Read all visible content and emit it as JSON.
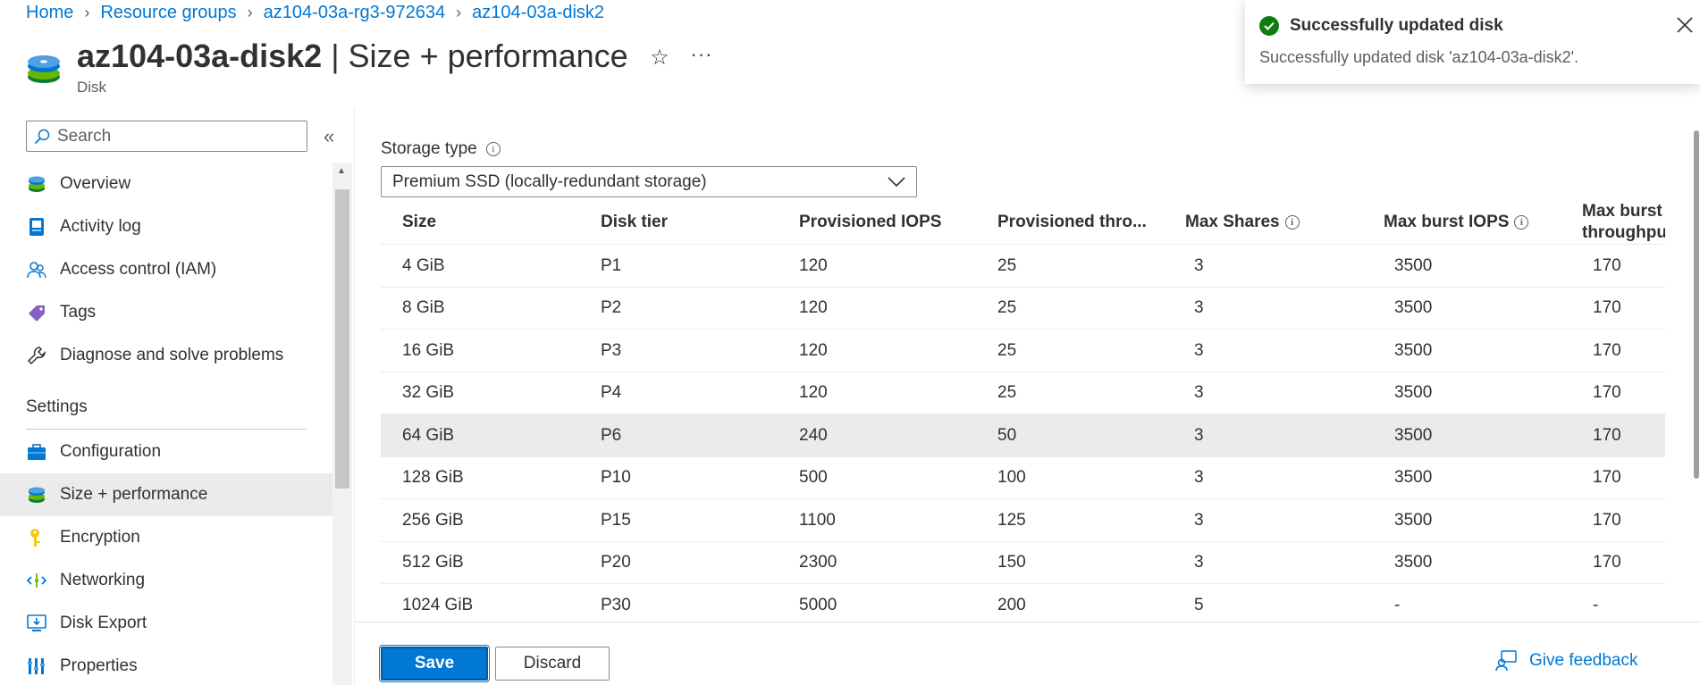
{
  "breadcrumb": [
    "Home",
    "Resource groups",
    "az104-03a-rg3-972634",
    "az104-03a-disk2"
  ],
  "header": {
    "title_resource": "az104-03a-disk2",
    "title_separator": " | ",
    "title_blade": "Size + performance",
    "subtitle": "Disk",
    "more_label": "···",
    "star_label": "☆"
  },
  "sidebar": {
    "search_placeholder": "Search",
    "collapse_label": "«",
    "items": [
      {
        "label": "Overview",
        "icon": "disk-icon"
      },
      {
        "label": "Activity log",
        "icon": "activity-log-icon"
      },
      {
        "label": "Access control (IAM)",
        "icon": "people-icon"
      },
      {
        "label": "Tags",
        "icon": "tag-icon"
      },
      {
        "label": "Diagnose and solve problems",
        "icon": "wrench-icon"
      }
    ],
    "settings_header": "Settings",
    "settings_items": [
      {
        "label": "Configuration",
        "icon": "toolbox-icon"
      },
      {
        "label": "Size + performance",
        "icon": "disk-icon"
      },
      {
        "label": "Encryption",
        "icon": "key-icon"
      },
      {
        "label": "Networking",
        "icon": "network-icon"
      },
      {
        "label": "Disk Export",
        "icon": "monitor-download-icon"
      },
      {
        "label": "Properties",
        "icon": "properties-icon"
      }
    ]
  },
  "storage": {
    "label": "Storage type",
    "selected": "Premium SSD (locally-redundant storage)"
  },
  "table": {
    "columns": [
      "Size",
      "Disk tier",
      "Provisioned IOPS",
      "Provisioned thro...",
      "Max Shares",
      "Max burst IOPS",
      "Max burst throughpu"
    ],
    "max_burst_line1": "Max burst",
    "max_burst_line2": "throughpu",
    "rows": [
      [
        "4 GiB",
        "P1",
        "120",
        "25",
        "3",
        "3500",
        "170"
      ],
      [
        "8 GiB",
        "P2",
        "120",
        "25",
        "3",
        "3500",
        "170"
      ],
      [
        "16 GiB",
        "P3",
        "120",
        "25",
        "3",
        "3500",
        "170"
      ],
      [
        "32 GiB",
        "P4",
        "120",
        "25",
        "3",
        "3500",
        "170"
      ],
      [
        "64 GiB",
        "P6",
        "240",
        "50",
        "3",
        "3500",
        "170"
      ],
      [
        "128 GiB",
        "P10",
        "500",
        "100",
        "3",
        "3500",
        "170"
      ],
      [
        "256 GiB",
        "P15",
        "1100",
        "125",
        "3",
        "3500",
        "170"
      ],
      [
        "512 GiB",
        "P20",
        "2300",
        "150",
        "3",
        "3500",
        "170"
      ],
      [
        "1024 GiB",
        "P30",
        "5000",
        "200",
        "5",
        "-",
        "-"
      ]
    ],
    "selected_row_index": 4
  },
  "actions": {
    "save": "Save",
    "discard": "Discard",
    "feedback": "Give feedback"
  },
  "toast": {
    "title": "Successfully updated disk",
    "message": "Successfully updated disk 'az104-03a-disk2'."
  },
  "colors": {
    "accent": "#0078d4",
    "success": "#107c10",
    "selected_row": "#ebebeb"
  }
}
